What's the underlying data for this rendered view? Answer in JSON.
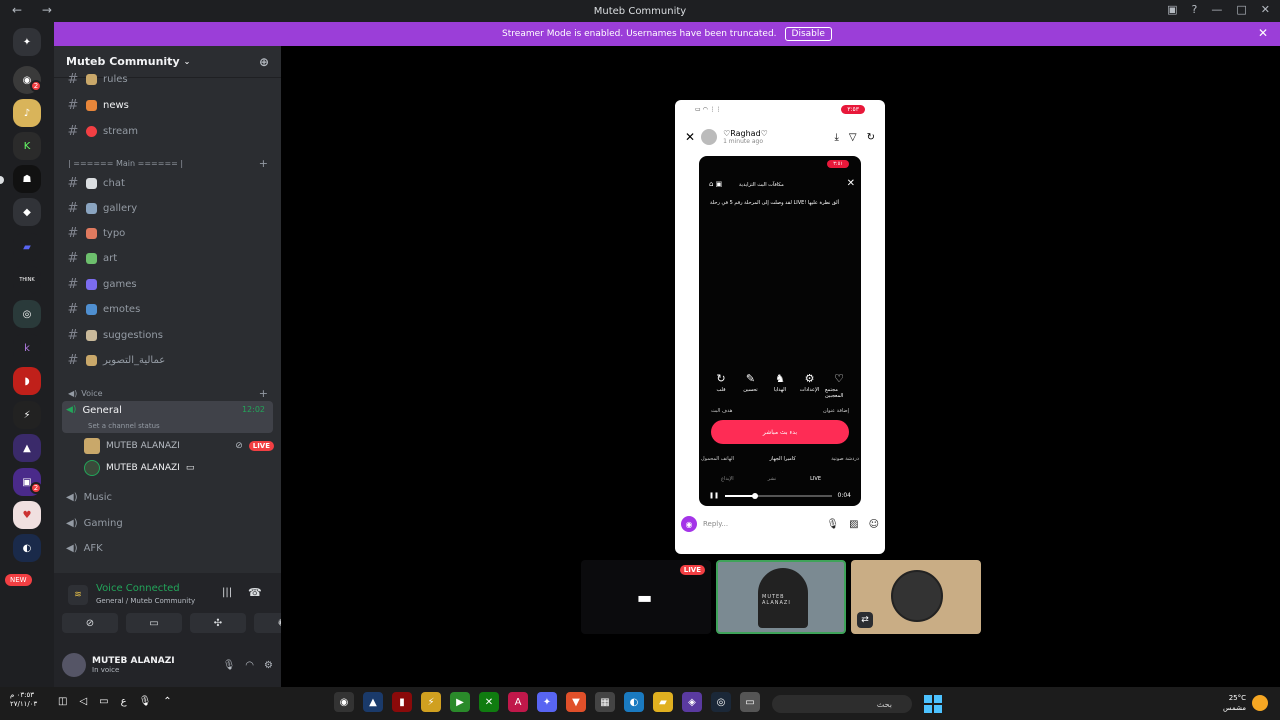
{
  "window": {
    "title": "Muteb Community"
  },
  "banner": {
    "text": "Streamer Mode is enabled. Usernames have been truncated.",
    "button": "Disable"
  },
  "guilds": {
    "badges": [
      "2",
      "2"
    ],
    "new_label": "NEW"
  },
  "server": {
    "name": "Muteb Community"
  },
  "channels": {
    "top": [
      {
        "name": "rules",
        "color": "#c9a86a"
      },
      {
        "name": "news",
        "color": "#e8863a"
      },
      {
        "name": "stream",
        "color": "#f23f43"
      }
    ],
    "main_category": "| ====== Main ====== |",
    "main": [
      {
        "name": "chat",
        "color": "#dbdee1"
      },
      {
        "name": "gallery",
        "color": "#8aa4c0"
      },
      {
        "name": "typo",
        "color": "#e07a5f"
      },
      {
        "name": "art",
        "color": "#6dbf6d"
      },
      {
        "name": "games",
        "color": "#7c6cf0"
      },
      {
        "name": "emotes",
        "color": "#4f8fd0"
      },
      {
        "name": "suggestions",
        "color": "#c9b99a"
      },
      {
        "name": "عمالية_التصوير",
        "color": "#c9a86a"
      }
    ],
    "voice_category": "Voice",
    "voice": [
      {
        "name": "General",
        "time": "12:02",
        "status": "Set a channel status"
      },
      {
        "name": "Music"
      },
      {
        "name": "Gaming"
      },
      {
        "name": "AFK"
      }
    ],
    "voice_users": [
      {
        "name": "MUTEB ALANAZI",
        "live": "LIVE"
      },
      {
        "name": "MUTEB ALANAZI"
      }
    ]
  },
  "voice_panel": {
    "title": "Voice Connected",
    "subtitle": "General / Muteb Community"
  },
  "user": {
    "name": "MUTEB ALANAZI",
    "status": "In voice"
  },
  "stream": {
    "phone_time": "٣:٥٣",
    "story_user": "♡Raghad♡",
    "story_time": "1 minute ago",
    "inner_time": "٣:٥١",
    "inner_title": "مكافآت البث التزايدية",
    "notif": "لقد وصلت إلى المرحلة رقم 5 في رحلة LIVE! ألق نظرة عليها",
    "icons": [
      "قلب",
      "تحسين",
      "الإعدادات",
      "مجتمع المعجبين",
      ""
    ],
    "icon_label_mid": "الهدايا",
    "row_left": "هدف البث",
    "row_right": "إضافة عنوان",
    "go_live": "بدء بث مباشر",
    "opts": [
      "الهاتف المحمول",
      "كاميرا الجهاز",
      "دردشة صوتية"
    ],
    "tabs": [
      "الإبداع",
      "نشر",
      "LIVE"
    ],
    "progress_time": "0:04",
    "progress": 0.28,
    "reply_placeholder": "Reply..."
  },
  "tiles": {
    "live_label": "LIVE",
    "art_text": "MUTEB ALANAZI"
  },
  "taskbar": {
    "clock_time": "٠٣:٥٣ م",
    "clock_date": "٢٧/١١/٠٣",
    "lang": "ع",
    "search": "بحث",
    "temp": "25°C",
    "weather": "مشمس"
  }
}
